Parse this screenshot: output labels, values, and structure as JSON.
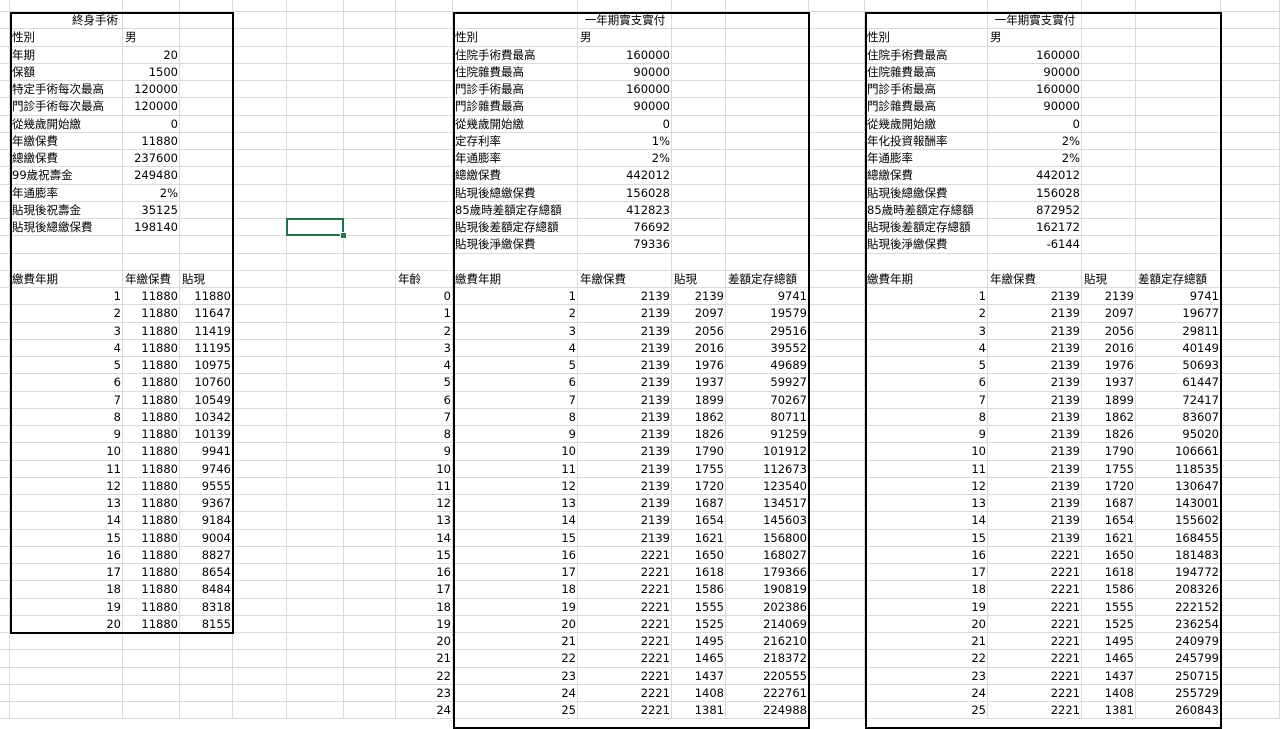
{
  "sheet": {
    "selected_cell": {
      "col": 5,
      "row": 12
    },
    "block1": {
      "title": "終身手術",
      "params": [
        [
          "性別",
          "男"
        ],
        [
          "年期",
          "20"
        ],
        [
          "保額",
          "1500"
        ],
        [
          "特定手術每次最高",
          "120000"
        ],
        [
          "門診手術每次最高",
          "120000"
        ],
        [
          "從幾歲開始繳",
          "0"
        ],
        [
          "年繳保費",
          "11880"
        ],
        [
          "總繳保費",
          "237600"
        ],
        [
          "99歲祝壽金",
          "249480"
        ],
        [
          "年通膨率",
          "2%"
        ],
        [
          "貼現後祝壽金",
          "35125"
        ],
        [
          "貼現後總繳保費",
          "198140"
        ]
      ],
      "headers": [
        "繳費年期",
        "年繳保費",
        "貼現"
      ],
      "rows": [
        [
          "1",
          "11880",
          "11880"
        ],
        [
          "2",
          "11880",
          "11647"
        ],
        [
          "3",
          "11880",
          "11419"
        ],
        [
          "4",
          "11880",
          "11195"
        ],
        [
          "5",
          "11880",
          "10975"
        ],
        [
          "6",
          "11880",
          "10760"
        ],
        [
          "7",
          "11880",
          "10549"
        ],
        [
          "8",
          "11880",
          "10342"
        ],
        [
          "9",
          "11880",
          "10139"
        ],
        [
          "10",
          "11880",
          "9941"
        ],
        [
          "11",
          "11880",
          "9746"
        ],
        [
          "12",
          "11880",
          "9555"
        ],
        [
          "13",
          "11880",
          "9367"
        ],
        [
          "14",
          "11880",
          "9184"
        ],
        [
          "15",
          "11880",
          "9004"
        ],
        [
          "16",
          "11880",
          "8827"
        ],
        [
          "17",
          "11880",
          "8654"
        ],
        [
          "18",
          "11880",
          "8484"
        ],
        [
          "19",
          "11880",
          "8318"
        ],
        [
          "20",
          "11880",
          "8155"
        ]
      ]
    },
    "block2": {
      "title": "一年期實支實付",
      "params": [
        [
          "性別",
          "男"
        ],
        [
          "住院手術費最高",
          "160000"
        ],
        [
          "住院雜費最高",
          "90000"
        ],
        [
          "門診手術最高",
          "160000"
        ],
        [
          "門診雜費最高",
          "90000"
        ],
        [
          "從幾歲開始繳",
          "0"
        ],
        [
          "定存利率",
          "1%"
        ],
        [
          "年通膨率",
          "2%"
        ],
        [
          "總繳保費",
          "442012"
        ],
        [
          "貼現後總繳保費",
          "156028"
        ],
        [
          "85歲時差額定存總額",
          "412823"
        ],
        [
          "貼現後差額定存總額",
          "76692"
        ],
        [
          "貼現後淨繳保費",
          "79336"
        ]
      ],
      "age_header": "年齡",
      "headers": [
        "繳費年期",
        "年繳保費",
        "貼現",
        "差額定存總額"
      ],
      "rows": [
        [
          "0",
          "1",
          "2139",
          "2139",
          "9741"
        ],
        [
          "1",
          "2",
          "2139",
          "2097",
          "19579"
        ],
        [
          "2",
          "3",
          "2139",
          "2056",
          "29516"
        ],
        [
          "3",
          "4",
          "2139",
          "2016",
          "39552"
        ],
        [
          "4",
          "5",
          "2139",
          "1976",
          "49689"
        ],
        [
          "5",
          "6",
          "2139",
          "1937",
          "59927"
        ],
        [
          "6",
          "7",
          "2139",
          "1899",
          "70267"
        ],
        [
          "7",
          "8",
          "2139",
          "1862",
          "80711"
        ],
        [
          "8",
          "9",
          "2139",
          "1826",
          "91259"
        ],
        [
          "9",
          "10",
          "2139",
          "1790",
          "101912"
        ],
        [
          "10",
          "11",
          "2139",
          "1755",
          "112673"
        ],
        [
          "11",
          "12",
          "2139",
          "1720",
          "123540"
        ],
        [
          "12",
          "13",
          "2139",
          "1687",
          "134517"
        ],
        [
          "13",
          "14",
          "2139",
          "1654",
          "145603"
        ],
        [
          "14",
          "15",
          "2139",
          "1621",
          "156800"
        ],
        [
          "15",
          "16",
          "2221",
          "1650",
          "168027"
        ],
        [
          "16",
          "17",
          "2221",
          "1618",
          "179366"
        ],
        [
          "17",
          "18",
          "2221",
          "1586",
          "190819"
        ],
        [
          "18",
          "19",
          "2221",
          "1555",
          "202386"
        ],
        [
          "19",
          "20",
          "2221",
          "1525",
          "214069"
        ],
        [
          "20",
          "21",
          "2221",
          "1495",
          "216210"
        ],
        [
          "21",
          "22",
          "2221",
          "1465",
          "218372"
        ],
        [
          "22",
          "23",
          "2221",
          "1437",
          "220555"
        ],
        [
          "23",
          "24",
          "2221",
          "1408",
          "222761"
        ],
        [
          "24",
          "25",
          "2221",
          "1381",
          "224988"
        ]
      ]
    },
    "block3": {
      "title": "一年期實支實付",
      "params": [
        [
          "性別",
          "男"
        ],
        [
          "住院手術費最高",
          "160000"
        ],
        [
          "住院雜費最高",
          "90000"
        ],
        [
          "門診手術最高",
          "160000"
        ],
        [
          "門診雜費最高",
          "90000"
        ],
        [
          "從幾歲開始繳",
          "0"
        ],
        [
          "年化投資報酬率",
          "2%"
        ],
        [
          "年通膨率",
          "2%"
        ],
        [
          "總繳保費",
          "442012"
        ],
        [
          "貼現後總繳保費",
          "156028"
        ],
        [
          "85歲時差額定存總額",
          "872952"
        ],
        [
          "貼現後差額定存總額",
          "162172"
        ],
        [
          "貼現後淨繳保費",
          "-6144"
        ]
      ],
      "headers": [
        "繳費年期",
        "年繳保費",
        "貼現",
        "差額定存總額"
      ],
      "rows": [
        [
          "1",
          "2139",
          "2139",
          "9741"
        ],
        [
          "2",
          "2139",
          "2097",
          "19677"
        ],
        [
          "3",
          "2139",
          "2056",
          "29811"
        ],
        [
          "4",
          "2139",
          "2016",
          "40149"
        ],
        [
          "5",
          "2139",
          "1976",
          "50693"
        ],
        [
          "6",
          "2139",
          "1937",
          "61447"
        ],
        [
          "7",
          "2139",
          "1899",
          "72417"
        ],
        [
          "8",
          "2139",
          "1862",
          "83607"
        ],
        [
          "9",
          "2139",
          "1826",
          "95020"
        ],
        [
          "10",
          "2139",
          "1790",
          "106661"
        ],
        [
          "11",
          "2139",
          "1755",
          "118535"
        ],
        [
          "12",
          "2139",
          "1720",
          "130647"
        ],
        [
          "13",
          "2139",
          "1687",
          "143001"
        ],
        [
          "14",
          "2139",
          "1654",
          "155602"
        ],
        [
          "15",
          "2139",
          "1621",
          "168455"
        ],
        [
          "16",
          "2221",
          "1650",
          "181483"
        ],
        [
          "17",
          "2221",
          "1618",
          "194772"
        ],
        [
          "18",
          "2221",
          "1586",
          "208326"
        ],
        [
          "19",
          "2221",
          "1555",
          "222152"
        ],
        [
          "20",
          "2221",
          "1525",
          "236254"
        ],
        [
          "21",
          "2221",
          "1495",
          "240979"
        ],
        [
          "22",
          "2221",
          "1465",
          "245799"
        ],
        [
          "23",
          "2221",
          "1437",
          "250715"
        ],
        [
          "24",
          "2221",
          "1408",
          "255729"
        ],
        [
          "25",
          "2221",
          "1381",
          "260843"
        ]
      ]
    }
  }
}
